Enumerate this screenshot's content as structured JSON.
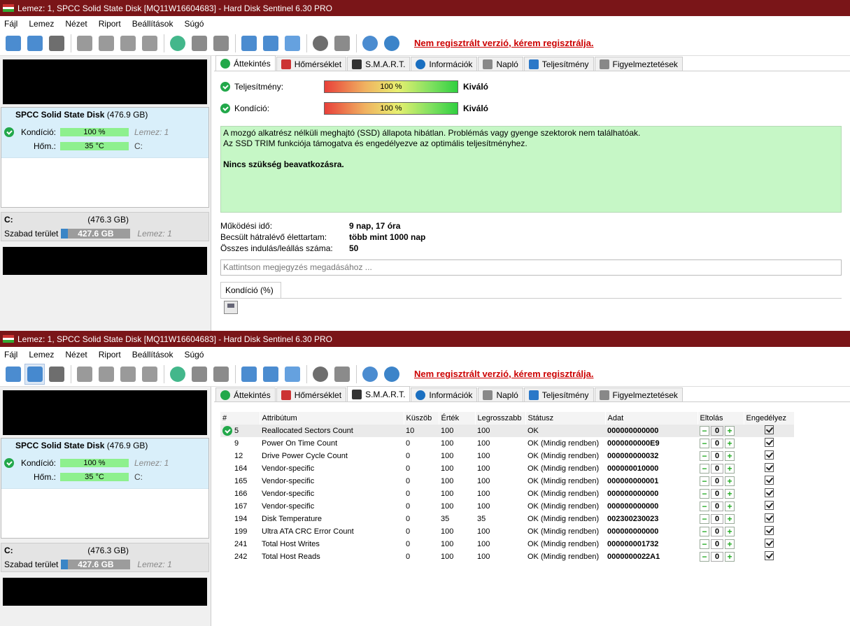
{
  "app": {
    "title": "Lemez: 1, SPCC Solid State Disk [MQ11W16604683]  -  Hard Disk Sentinel 6.30 PRO",
    "menu": [
      "Fájl",
      "Lemez",
      "Nézet",
      "Riport",
      "Beállítások",
      "Súgó"
    ],
    "register_link": "Nem regisztrált verzió, kérem regisztrálja."
  },
  "disk": {
    "name": "SPCC Solid State Disk",
    "size": "(476.9 GB)",
    "health_label": "Kondíció:",
    "health_value": "100 %",
    "health_disk": "Lemez: 1",
    "temp_label": "Hőm.:",
    "temp_value": "35 °C",
    "temp_drive": "C:"
  },
  "volume": {
    "letter": "C:",
    "size": "(476.3 GB)",
    "free_label": "Szabad terület",
    "free_value": "427.6 GB",
    "disk": "Lemez: 1"
  },
  "tabs": [
    "Áttekintés",
    "Hőmérséklet",
    "S.M.A.R.T.",
    "Információk",
    "Napló",
    "Teljesítmény",
    "Figyelmeztetések"
  ],
  "overview": {
    "perf_label": "Teljesítmény:",
    "perf_value": "100 %",
    "perf_text": "Kiváló",
    "health_label": "Kondíció:",
    "health_value": "100 %",
    "health_text": "Kiváló",
    "msg1": "A mozgó alkatrész nélküli meghajtó (SSD) állapota hibátlan. Problémás vagy gyenge szektorok nem találhatóak.",
    "msg2": "Az SSD TRIM funkciója támogatva és engedélyezve az optimális teljesítményhez.",
    "msg3": "Nincs szükség beavatkozásra.",
    "uptime_label": "Működési idő:",
    "uptime_value": "9 nap, 17 óra",
    "life_label": "Becsült hátralévő élettartam:",
    "life_value": "több mint 1000 nap",
    "starts_label": "Összes indulás/leállás száma:",
    "starts_value": "50",
    "note_placeholder": "Kattintson megjegyzés megadásához ...",
    "subtab": "Kondíció  (%)"
  },
  "smart": {
    "headers": [
      "#",
      "Attribútum",
      "Küszöb",
      "Érték",
      "Legrosszabb",
      "Státusz",
      "Adat",
      "Eltolás",
      "Engedélyez"
    ],
    "rows": [
      [
        "5",
        "Reallocated Sectors Count",
        "10",
        "100",
        "100",
        "OK",
        "000000000000",
        "0"
      ],
      [
        "9",
        "Power On Time Count",
        "0",
        "100",
        "100",
        "OK (Mindig rendben)",
        "0000000000E9",
        "0"
      ],
      [
        "12",
        "Drive Power Cycle Count",
        "0",
        "100",
        "100",
        "OK (Mindig rendben)",
        "000000000032",
        "0"
      ],
      [
        "164",
        "Vendor-specific",
        "0",
        "100",
        "100",
        "OK (Mindig rendben)",
        "000000010000",
        "0"
      ],
      [
        "165",
        "Vendor-specific",
        "0",
        "100",
        "100",
        "OK (Mindig rendben)",
        "000000000001",
        "0"
      ],
      [
        "166",
        "Vendor-specific",
        "0",
        "100",
        "100",
        "OK (Mindig rendben)",
        "000000000000",
        "0"
      ],
      [
        "167",
        "Vendor-specific",
        "0",
        "100",
        "100",
        "OK (Mindig rendben)",
        "000000000000",
        "0"
      ],
      [
        "194",
        "Disk Temperature",
        "0",
        "35",
        "35",
        "OK (Mindig rendben)",
        "002300230023",
        "0"
      ],
      [
        "199",
        "Ultra ATA CRC Error Count",
        "0",
        "100",
        "100",
        "OK (Mindig rendben)",
        "000000000000",
        "0"
      ],
      [
        "241",
        "Total Host Writes",
        "0",
        "100",
        "100",
        "OK (Mindig rendben)",
        "000000001732",
        "0"
      ],
      [
        "242",
        "Total Host Reads",
        "0",
        "100",
        "100",
        "OK (Mindig rendben)",
        "0000000022A1",
        "0"
      ]
    ]
  },
  "colors": {
    "titlebar": "#7a1518",
    "accent_green": "#22a84a",
    "message_bg": "#c6f7c6"
  }
}
